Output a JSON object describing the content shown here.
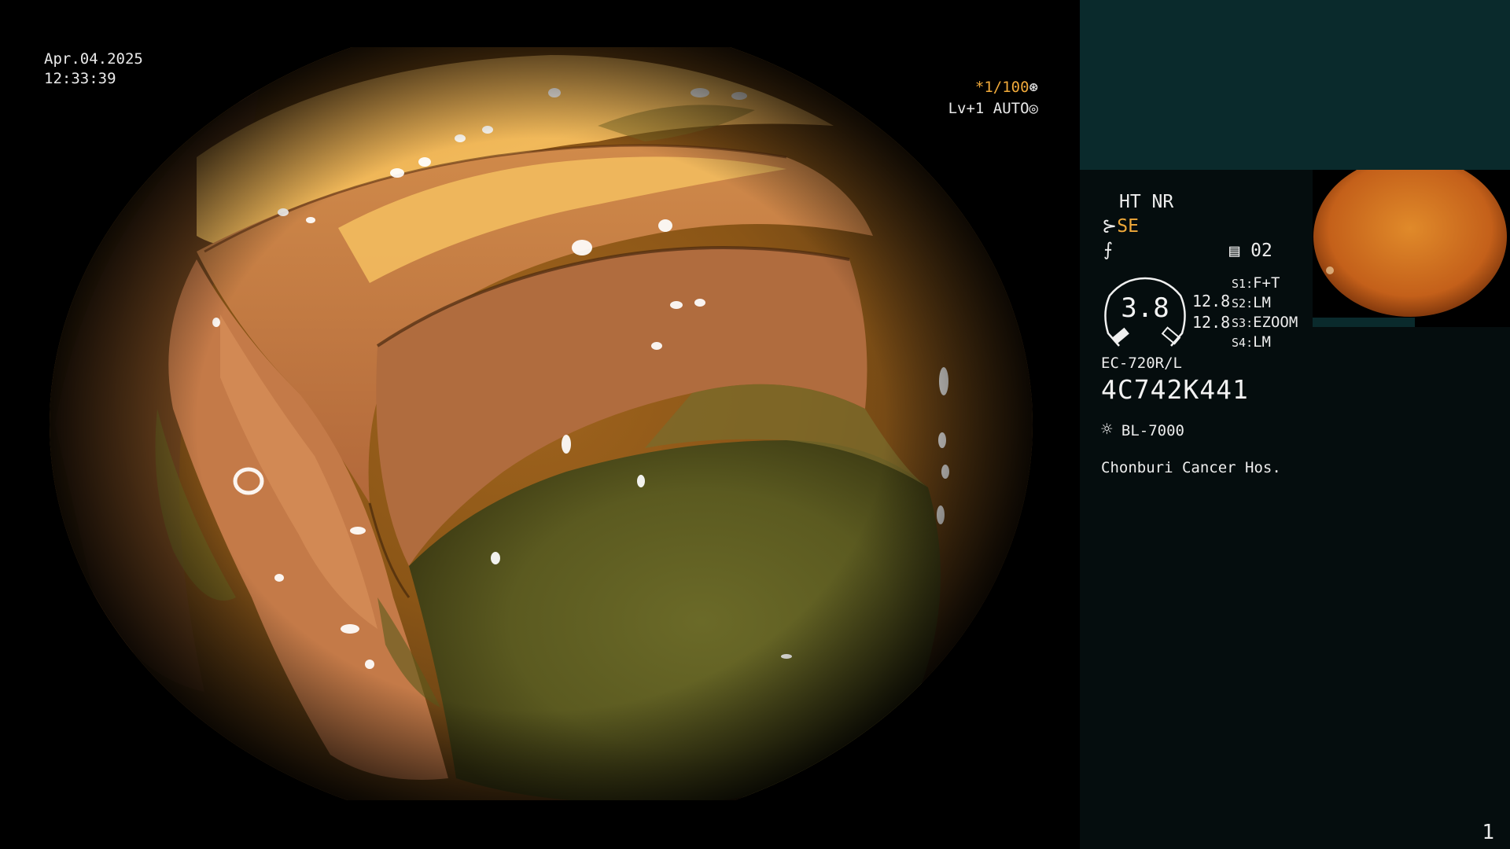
{
  "main": {
    "date": "Apr.04.2025",
    "time": "12:33:39",
    "shutter": "*1/100",
    "shutter_icon": "aperture-icon",
    "level_mode": "Lv+1 AUTO",
    "mode_icon": "auto-iris-icon"
  },
  "panel": {
    "ht_nr": "HT NR",
    "se_label": "SE",
    "se_icon": "structure-enhance-icon",
    "filter_icon": "color-filter-icon",
    "memory_icon": "memory-card-icon",
    "memory_value": "02",
    "zoom_value": "3.8",
    "gain_1": "12.8",
    "gain_2": "12.8",
    "switches": [
      {
        "key": "S1",
        "sep": ":",
        "value": "F+T"
      },
      {
        "key": "S2",
        "sep": ":",
        "value": "LM"
      },
      {
        "key": "S3",
        "sep": ":",
        "value": "EZOOM"
      },
      {
        "key": "S4",
        "sep": ":",
        "value": "LM"
      }
    ],
    "scope_model": "EC-720R/L",
    "scope_serial": "4C742K441",
    "light_icon": "light-source-icon",
    "light_source": "BL-7000",
    "hospital": "Chonburi Cancer Hos.",
    "page_number": "1"
  },
  "colors": {
    "accent_orange": "#f0a93a",
    "panel_bg": "#050d0e",
    "preview_band": "#0a2a2c"
  }
}
